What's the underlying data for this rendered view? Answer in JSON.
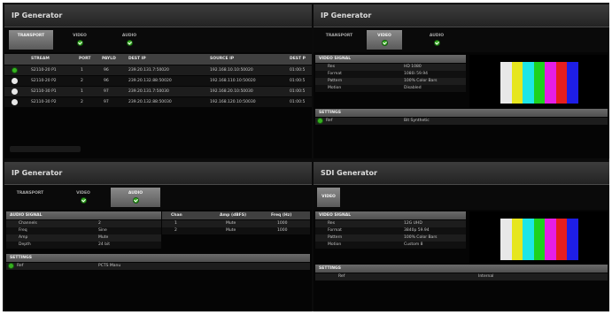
{
  "panels": {
    "top_left": {
      "title": "IP Generator",
      "tabs": [
        "TRANSPORT",
        "VIDEO",
        "AUDIO"
      ],
      "columns": [
        "STREAM",
        "PORT",
        "PAYLD",
        "DEST IP",
        "SOURCE IP",
        "DEST P"
      ],
      "rows": [
        {
          "status": "green",
          "stream": "S2110-20 P1",
          "port": "1",
          "payld": "96",
          "dest_ip": "239.20.131.7:50020",
          "source_ip": "192.168.10.10:50020",
          "dest_p": "01:00:5"
        },
        {
          "status": "white",
          "stream": "S2110-20 P2",
          "port": "2",
          "payld": "96",
          "dest_ip": "239.20.132.88:50020",
          "source_ip": "192.168.110.10:50020",
          "dest_p": "01:00:5"
        },
        {
          "status": "white",
          "stream": "S2110-30 P1",
          "port": "1",
          "payld": "97",
          "dest_ip": "239.20.131.7:50030",
          "source_ip": "192.168.20.10:50030",
          "dest_p": "01:00:5"
        },
        {
          "status": "white",
          "stream": "S2110-30 P2",
          "port": "2",
          "payld": "97",
          "dest_ip": "239.20.132.88:50030",
          "source_ip": "192.168.120.10:50030",
          "dest_p": "01:00:5"
        }
      ]
    },
    "top_right": {
      "title": "IP Generator",
      "tabs": [
        "TRANSPORT",
        "VIDEO",
        "AUDIO"
      ],
      "section_video": "VIDEO SIGNAL",
      "video_fields": [
        {
          "label": "Res",
          "value": "HD 1080"
        },
        {
          "label": "Format",
          "value": "1080i 59.94"
        },
        {
          "label": "Pattern",
          "value": "100% Color Bars"
        },
        {
          "label": "Motion",
          "value": "Disabled"
        }
      ],
      "section_settings": "SETTINGS",
      "settings_row": {
        "label": "Ref",
        "value": "Bit Synthetic"
      }
    },
    "bottom_left": {
      "title": "IP Generator",
      "tabs": [
        "TRANSPORT",
        "VIDEO",
        "AUDIO"
      ],
      "section_audio": "AUDIO SIGNAL",
      "audio_fields": [
        {
          "label": "Channels",
          "value": "2"
        },
        {
          "label": "Freq",
          "value": "Sine"
        },
        {
          "label": "Amp",
          "value": "Mute"
        },
        {
          "label": "Depth",
          "value": "24 bit"
        }
      ],
      "channel_headers": [
        "Chan",
        "Amp (dBFS)",
        "Freq (Hz)"
      ],
      "channel_rows": [
        {
          "chan": "1",
          "amp": "Mute",
          "freq": "1000"
        },
        {
          "chan": "2",
          "amp": "Mute",
          "freq": "1000"
        }
      ],
      "section_settings": "SETTINGS",
      "settings_row": {
        "label": "Ref",
        "value": "PCTS Manu"
      }
    },
    "bottom_right": {
      "title": "SDI Generator",
      "tabs": [
        "VIDEO"
      ],
      "section_video": "VIDEO SIGNAL",
      "video_fields": [
        {
          "label": "Res",
          "value": "12G UHD"
        },
        {
          "label": "Format",
          "value": "3840p 59.94"
        },
        {
          "label": "Pattern",
          "value": "100% Color Bars"
        },
        {
          "label": "Motion",
          "value": "Custom 8"
        }
      ],
      "section_settings": "SETTINGS",
      "settings_row": {
        "label": "Ref",
        "value": "Internal"
      }
    }
  },
  "colors": {
    "bars": [
      "#e8e8e8",
      "#e6e61e",
      "#1ee6e6",
      "#1ed21e",
      "#e61ee6",
      "#e61e1e",
      "#1e1ee6"
    ],
    "status_ok": "#36b31f"
  }
}
